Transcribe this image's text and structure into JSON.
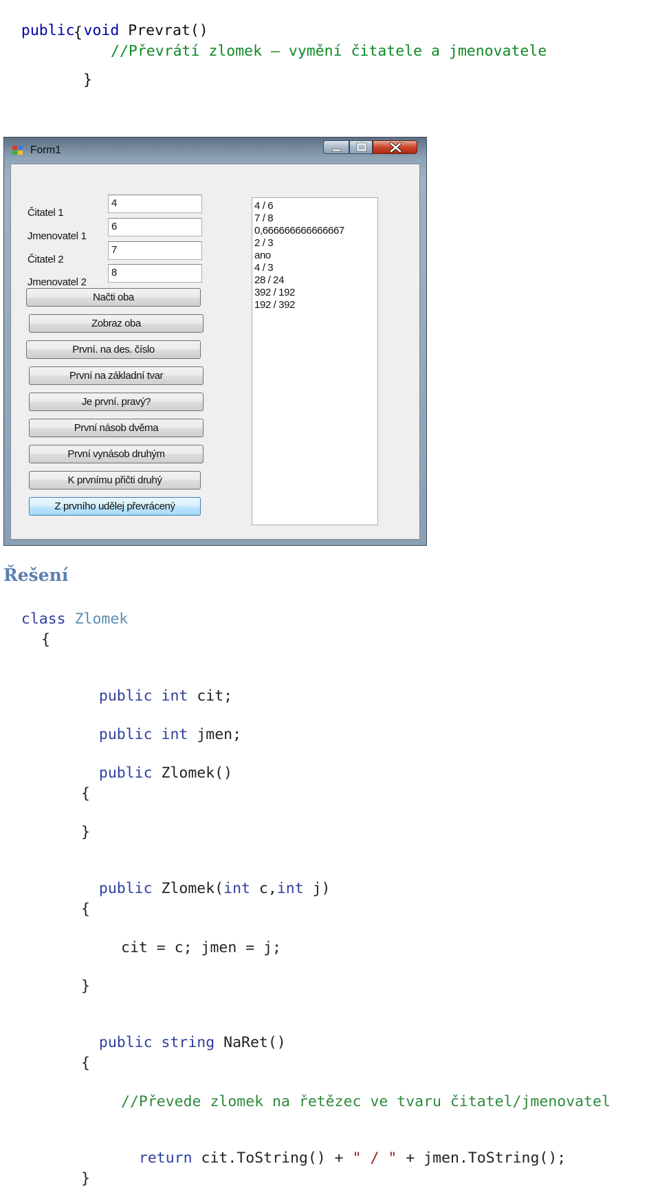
{
  "code_top": {
    "line1_kw1": "public",
    "line1_kw2": "void",
    "line1_rest": "Prevrat()",
    "line2": "{",
    "line3": "//Převrátí zlomek – vymění čitatele a jmenovatele",
    "line4": "}"
  },
  "form": {
    "title": "Form1",
    "labels": [
      "Čitatel 1",
      "Jmenovatel 1",
      "Čitatel 2",
      "Jmenovatel 2"
    ],
    "values": [
      "4",
      "6",
      "7",
      "8"
    ],
    "buttons": [
      "Načti oba",
      "Zobraz oba",
      "První. na des. číslo",
      "První na základní tvar",
      "Je první. pravý?",
      "První násob dvěma",
      "První vynásob druhým",
      "K prvnímu přičti druhý",
      "Z prvního udělej převrácený"
    ],
    "list_items": [
      "4 / 6",
      "7 / 8",
      "0,666666666666667",
      "2 / 3",
      "ano",
      "4 / 3",
      "28 / 24",
      "392 / 192",
      "192 / 392"
    ]
  },
  "heading": "Řešení",
  "code_class": {
    "class_kw": "class",
    "class_name": "Zlomek",
    "open": "{",
    "public": "public",
    "int": "int",
    "string": "string",
    "field1_name": "cit;",
    "field2_name": "jmen;",
    "ctor1": "Zlomek()",
    "brace_open": "{",
    "brace_close": "}",
    "ctor2_name": "Zlomek(",
    "ctor2_param1": "c,",
    "ctor2_param2": "j)",
    "assign": "cit = c; jmen = j;",
    "method_name": "NaRet()",
    "comment": "//Převede zlomek na řetězec ve tvaru čitatel/jmenovatel",
    "return_kw": "return",
    "return_a": "cit.ToString() + ",
    "return_str": "\" / \"",
    "return_b": " + jmen.ToString();"
  }
}
